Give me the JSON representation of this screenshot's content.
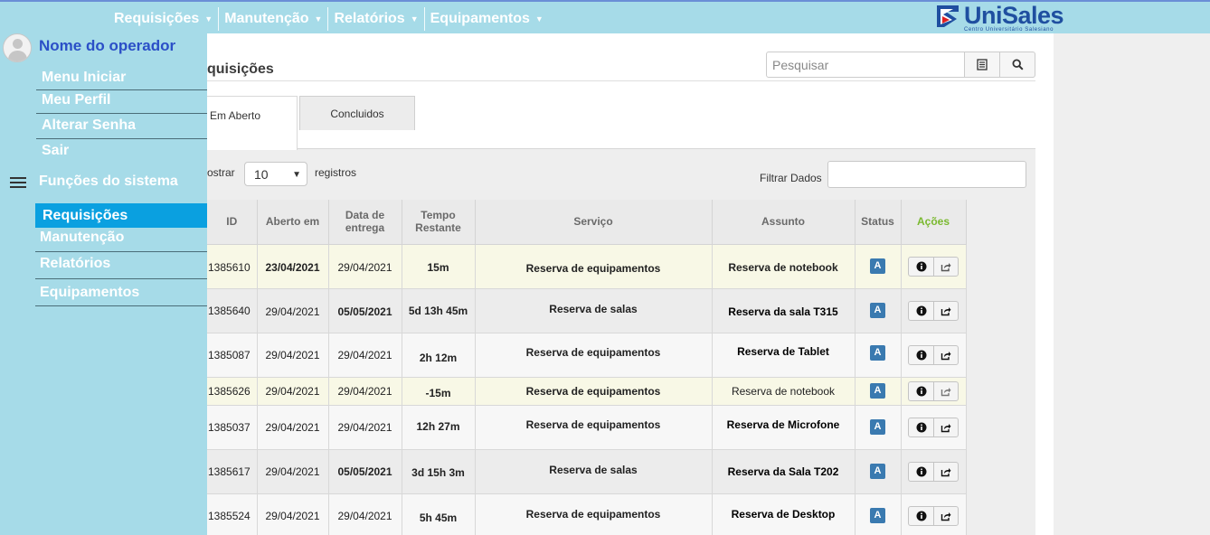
{
  "topnav": {
    "items": [
      {
        "label": "Requisições"
      },
      {
        "label": "Manutenção"
      },
      {
        "label": "Relatórios"
      },
      {
        "label": "Equipamentos"
      }
    ],
    "caret_icon": "chevron-down-icon"
  },
  "logo": {
    "name": "UniSales",
    "subtitle": "Centro Universitário Salesiano",
    "color": "#1f4fa0",
    "accent": "#e02020"
  },
  "sidebar": {
    "operator": "Nome do operador",
    "user_menu": [
      {
        "label": "Menu Iniciar"
      },
      {
        "label": "Meu Perfil"
      },
      {
        "label": "Alterar Senha"
      },
      {
        "label": "Sair"
      }
    ],
    "functions_title": "Funções do sistema",
    "functions": [
      {
        "label": "Requisições",
        "active": true
      },
      {
        "label": "Manutenção"
      },
      {
        "label": "Relatórios"
      },
      {
        "label": "Equipamentos"
      }
    ],
    "bg_color": "#a6dbe8",
    "active_color": "#0aa0e0"
  },
  "main": {
    "title": "quisições",
    "search_placeholder": "Pesquisar",
    "tabs": [
      {
        "label": "Em Aberto",
        "active": true
      },
      {
        "label": "Concluidos"
      }
    ],
    "show_label": "ostrar",
    "page_size": "10",
    "records_label": "registros",
    "filter_label": "Filtrar Dados",
    "table": {
      "headers": [
        "ID",
        "Aberto em",
        "Data de entrega",
        "Tempo Restante",
        "Serviço",
        "Assunto",
        "Status",
        "Ações"
      ],
      "rows": [
        {
          "id": "1385610",
          "aberto": "23/04/2021",
          "entrega": "29/04/2021",
          "tempo": "15m",
          "servico": "Reserva de equipamentos",
          "assunto": "Reserva de notebook",
          "status": "A"
        },
        {
          "id": "1385640",
          "aberto": "29/04/2021",
          "entrega": "05/05/2021",
          "tempo": "5d 13h 45m",
          "servico": "Reserva de salas",
          "assunto": "Reserva da sala T315",
          "status": "A"
        },
        {
          "id": "1385087",
          "aberto": "29/04/2021",
          "entrega": "29/04/2021",
          "tempo": "2h 12m",
          "servico": "Reserva de equipamentos",
          "assunto": "Reserva de Tablet",
          "status": "A"
        },
        {
          "id": "1385626",
          "aberto": "29/04/2021",
          "entrega": "29/04/2021",
          "tempo": "-15m",
          "servico": "Reserva de equipamentos",
          "assunto": "Reserva de notebook",
          "status": "A"
        },
        {
          "id": "1385037",
          "aberto": "29/04/2021",
          "entrega": "29/04/2021",
          "tempo": "12h 27m",
          "servico": "Reserva de equipamentos",
          "assunto": "Reserva de Microfone",
          "status": "A"
        },
        {
          "id": "1385617",
          "aberto": "29/04/2021",
          "entrega": "05/05/2021",
          "tempo": "3d 15h 3m",
          "servico": "Reserva de salas",
          "assunto": "Reserva da Sala T202",
          "status": "A"
        },
        {
          "id": "1385524",
          "aberto": "29/04/2021",
          "entrega": "29/04/2021",
          "tempo": "5h 45m",
          "servico": "Reserva de equipamentos",
          "assunto": "Reserva de Desktop",
          "status": "A"
        }
      ],
      "row_icons": [
        "info-icon",
        "share-icon"
      ]
    }
  }
}
